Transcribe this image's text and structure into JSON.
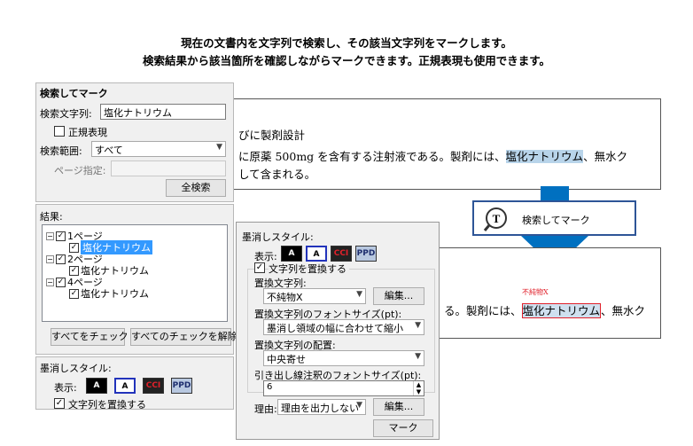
{
  "headline": {
    "line1": "現在の文書内を文字列で検索し、その該当文字列をマークします。",
    "line2": "検索結果から該当箇所を確認しながらマークできます。正規表現も使用できます。"
  },
  "doc_top": {
    "line1": "びに製剤設計",
    "line2_pre": "に原薬 500mg を含有する注射液である。製剤には、",
    "line2_hl": "塩化ナトリウム",
    "line2_post": "、無水ク",
    "line3": "して含まれる。"
  },
  "doc_bottom": {
    "line1_pre": "る。製剤には、",
    "line1_hl": "塩化ナトリウム",
    "line1_post": "、無水ク",
    "note": "不純物X"
  },
  "callout": {
    "label": "検索してマーク",
    "icon_letter": "T",
    "accent": "#0070c0"
  },
  "search_panel": {
    "title": "検索してマーク",
    "search_label": "検索文字列:",
    "search_value": "塩化ナトリウム",
    "regex_label": "正規表現",
    "scope_label": "検索範囲:",
    "scope_value": "すべて",
    "page_label": "ページ指定:",
    "search_all_button": "全検索",
    "results_label": "結果:",
    "results": [
      {
        "page": "1ページ",
        "item": "塩化ナトリウム",
        "selected": true
      },
      {
        "page": "2ページ",
        "item": "塩化ナトリウム",
        "selected": false
      },
      {
        "page": "4ページ",
        "item": "塩化ナトリウム",
        "selected": false
      }
    ],
    "check_all_button": "すべてをチェック",
    "uncheck_all_button": "すべてのチェックを解除",
    "redaction_style_label": "墨消しスタイル:",
    "display_label": "表示:",
    "replace_label": "文字列を置換する"
  },
  "style_panel": {
    "title": "墨消しスタイル:",
    "display_label": "表示:",
    "styles": [
      "A",
      "A",
      "CCI",
      "PPD"
    ],
    "replace_label": "文字列を置換する",
    "replace_text_label": "置換文字列:",
    "replace_text_value": "不純物X",
    "edit_button": "編集...",
    "font_size_label": "置換文字列のフォントサイズ(pt):",
    "font_size_value": "墨消し領域の幅に合わせて縮小",
    "placement_label": "置換文字列の配置:",
    "placement_value": "中央寄せ",
    "leader_size_label": "引き出し線注釈のフォントサイズ(pt):",
    "leader_size_value": "6",
    "reason_label": "理由:",
    "reason_value": "理由を出力しない",
    "reason_edit_button": "編集...",
    "mark_button": "マーク"
  }
}
